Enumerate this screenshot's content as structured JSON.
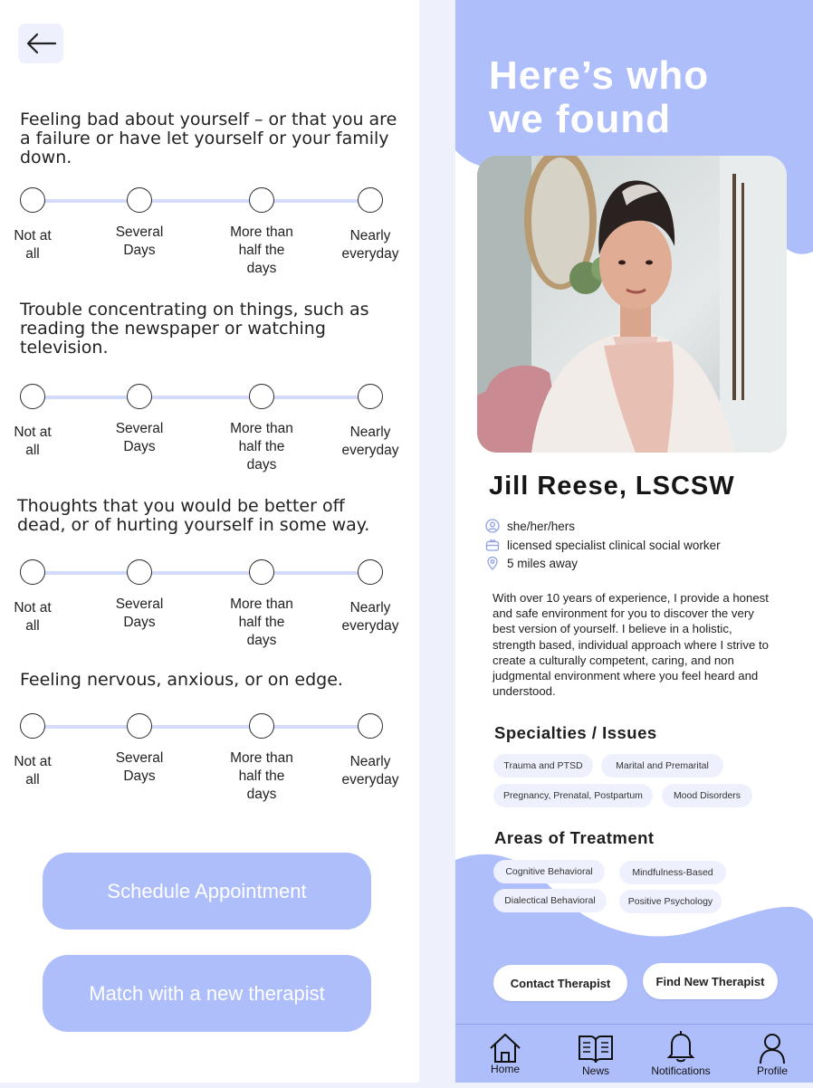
{
  "left": {
    "questions": [
      {
        "text": "Feeling bad about yourself – or that you are a failure or have let yourself or your family down."
      },
      {
        "text": "Trouble concentrating on things, such as reading the newspaper or watching television."
      },
      {
        "text": "Thoughts that you would be better off dead, or of hurting yourself in some way."
      },
      {
        "text": "Feeling nervous, anxious, or on edge."
      }
    ],
    "options": [
      "Not at all",
      "Several Days",
      "More than half the days",
      "Nearly everyday"
    ],
    "schedule_label": "Schedule Appointment",
    "match_label": "Match with a new therapist"
  },
  "right": {
    "heading_line1": "Here’s who",
    "heading_line2": "we found",
    "name": "Jill Reese, LSCSW",
    "pronouns": "she/her/hers",
    "credential": "licensed specialist clinical social worker",
    "distance": "5 miles away",
    "bio": "With over 10 years of experience, I provide a honest and safe environment for you to discover the very best version of yourself. I believe in a holistic, strength based, individual approach where I strive to create a culturally competent, caring, and non judgmental environment where you feel heard and understood.",
    "specialties_title": "Specialties / Issues",
    "specialties": [
      "Trauma and PTSD",
      "Marital and Premarital",
      "Pregnancy, Prenatal, Postpartum",
      "Mood Disorders"
    ],
    "treatment_title": "Areas of Treatment",
    "treatments": [
      "Cognitive Behavioral",
      "Mindfulness-Based",
      "Dialectical Behavioral",
      "Positive Psychology"
    ],
    "contact_label": "Contact Therapist",
    "find_label": "Find New Therapist",
    "nav": [
      "Home",
      "News",
      "Notifications",
      "Profile"
    ]
  },
  "colors": {
    "accent": "#aebefa",
    "chip": "#eef1fd",
    "track": "#d3dafc"
  }
}
